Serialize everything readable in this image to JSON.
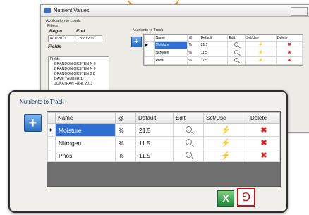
{
  "window": {
    "title": "Nutrient Values",
    "apply_label": "Application to Loads",
    "filters_label": "Filters",
    "begin_label": "Begin",
    "end_label": "End",
    "begin_date": "8/ 1/2011",
    "end_date": "12/20/2011",
    "fields_label": "Fields",
    "fields": [
      "Fields",
      "BRANDON ORSTEN N 6",
      "BRANDON ORSTEN N 6",
      "BRANDON ORSTEN 0 8",
      "DAVE TAUBER 1",
      "JONATHAN FAHL 2011"
    ],
    "mini_section": "Nutrients to Track"
  },
  "panel": {
    "title": "Nutrients to Track",
    "columns": [
      "Name",
      "@",
      "Default",
      "Edit",
      "Set/Use",
      "Delete"
    ],
    "rows": [
      {
        "name": "Moisture",
        "unit": "%",
        "default": "21.5"
      },
      {
        "name": "Nitrogen",
        "unit": "%",
        "default": "11.5"
      },
      {
        "name": "Phos",
        "unit": "%",
        "default": "11.5"
      }
    ],
    "selected_row": 0,
    "row_pointer": "▶"
  },
  "icons": {
    "add": "plus-icon",
    "edit": "magnifier-icon",
    "set_use": "lightning-icon",
    "delete": "x-icon",
    "excel": "excel-export-icon",
    "pdf": "pdf-export-icon",
    "excel_glyph": "X",
    "pdf_glyph": "⅁"
  },
  "colors": {
    "accent": "#f39a1e",
    "selection": "#2d6fd2",
    "delete": "#d32020",
    "bolt": "#f2b100"
  }
}
